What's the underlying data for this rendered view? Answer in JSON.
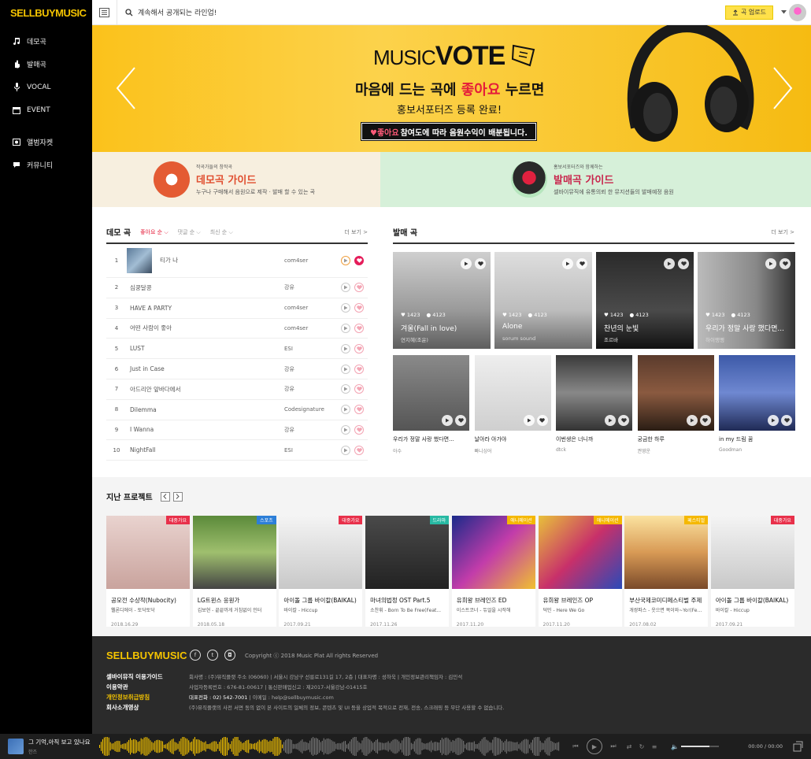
{
  "brand": {
    "logo": "SELLBUYMUSIC"
  },
  "sidebar": {
    "main": [
      {
        "label": "데모곡",
        "icon": "music-note-icon"
      },
      {
        "label": "발매곡",
        "icon": "hand-icon"
      },
      {
        "label": "VOCAL",
        "icon": "microphone-icon"
      },
      {
        "label": "EVENT",
        "icon": "calendar-icon"
      }
    ],
    "sub": [
      {
        "label": "앨범자켓",
        "icon": "album-icon"
      },
      {
        "label": "커뮤니티",
        "icon": "chat-icon"
      }
    ]
  },
  "topbar": {
    "search_value": "계속해서 공개되는 라인업!",
    "upload_label": "곡 업로드"
  },
  "banner": {
    "title_pre": "MUSIC",
    "title_main": "VOTE",
    "headline_pre": "마음에 드는 곡에 ",
    "headline_em": "좋아요",
    "headline_post": " 누르면",
    "subline": "홍보서포터즈 등록 완료!",
    "strip_em": "♥좋아요",
    "strip_text": " 참여도에 따라 음원수익이 배분됩니다."
  },
  "guides": {
    "demo": {
      "small": "작곡가들의 창작곡",
      "title": "데모곡 가이드",
      "desc": "누구나 구매해서 음원으로 제작 · 발매 할 수 있는 곡"
    },
    "release": {
      "small": "홍보서포터즈와 함께하는",
      "title": "발매곡 가이드",
      "desc": "셀바이뮤직에 유통의뢰 한 뮤지션들의 발매예정 음원"
    }
  },
  "demo": {
    "title": "데모 곡",
    "sorts": [
      "좋아요 순",
      "댓글 순",
      "최신 순"
    ],
    "more": "더 보기 >",
    "items": [
      {
        "rank": "1",
        "title": "티가 나",
        "artist": "com4ser"
      },
      {
        "rank": "2",
        "title": "심쿵달콩",
        "artist": "강유"
      },
      {
        "rank": "3",
        "title": "HAVE A PARTY",
        "artist": "com4ser"
      },
      {
        "rank": "4",
        "title": "어떤 사람이 좋아",
        "artist": "com4ser"
      },
      {
        "rank": "5",
        "title": "LUST",
        "artist": "ESI"
      },
      {
        "rank": "6",
        "title": "Just in Case",
        "artist": "강유"
      },
      {
        "rank": "7",
        "title": "아드리안 앞바다에서",
        "artist": "강유"
      },
      {
        "rank": "8",
        "title": "Dilemma",
        "artist": "Codesignature"
      },
      {
        "rank": "9",
        "title": "I Wanna",
        "artist": "강유"
      },
      {
        "rank": "10",
        "title": "NightFall",
        "artist": "ESI"
      }
    ]
  },
  "release": {
    "title": "발매 곡",
    "more": "더 보기 >",
    "featured": [
      {
        "title": "겨울(Fall in love)",
        "artist": "연지혜(조윤)",
        "likes": "1423",
        "comments": "4123"
      },
      {
        "title": "Alone",
        "artist": "sorum sound",
        "likes": "1423",
        "comments": "4123"
      },
      {
        "title": "찬년의 눈빛",
        "artist": "조르바",
        "likes": "1423",
        "comments": "4123"
      },
      {
        "title": "우리가 정말 사랑 했다면...",
        "artist": "하이맹멩",
        "likes": "1423",
        "comments": "4123"
      }
    ],
    "small": [
      {
        "title": "우리가 정말 사랑 했다면...",
        "artist": "아수"
      },
      {
        "title": "날아라 아가야",
        "artist": "빠니싱어"
      },
      {
        "title": "이번생은 너니까",
        "artist": "dtck"
      },
      {
        "title": "궁금한 하루",
        "artist": "권영운"
      },
      {
        "title": "in my 드림 꿈",
        "artist": "Goodman"
      }
    ]
  },
  "past": {
    "title": "지난 프로젝트",
    "items": [
      {
        "tag": "대중가요",
        "title": "공모전 수상작(Nubocity)",
        "sub": "웰론디에이 - 토닥토닥",
        "date": "2018.16.29",
        "tag_color": "#e8304a"
      },
      {
        "tag": "스포츠",
        "title": "LG트윈스 응원가",
        "sub": "김보현 - 끝끝까게 거침없이 인터",
        "date": "2018.05.18",
        "tag_color": "#2d7fd8"
      },
      {
        "tag": "대중가요",
        "title": "아이돌 그룹 바이칼(BAIKAL)",
        "sub": "바이칼 - Hiccup",
        "date": "2017.09.21",
        "tag_color": "#e8304a"
      },
      {
        "tag": "드라마",
        "title": "마녀의법정 OST Part.5",
        "sub": "소찬휘 - Born To Be Free(Feat...",
        "date": "2017.11.26",
        "tag_color": "#27b9a3"
      },
      {
        "tag": "애니메이션",
        "title": "유희왕 브레인즈 ED",
        "sub": "이스트코너 - 듀얼을 시작해",
        "date": "2017.11.20",
        "tag_color": "#f5b800"
      },
      {
        "tag": "애니메이션",
        "title": "유희왕 브레인즈 OP",
        "sub": "덕민 - Here We Go",
        "date": "2017.11.20",
        "tag_color": "#f5b800"
      },
      {
        "tag": "페스티벌",
        "title": "부산국제코미디페스티벌 주제",
        "sub": "개쌍파스 - 웃으면 복이와~Yo!(Feat.유",
        "date": "2017.08.02",
        "tag_color": "#f5b800"
      },
      {
        "tag": "대중가요",
        "title": "아이돌 그룹 바이칼(BAIKAL)",
        "sub": "바이칼 - Hiccup",
        "date": "2017.09.21",
        "tag_color": "#e8304a"
      }
    ]
  },
  "footer": {
    "logo": "SELLBUYMUSIC",
    "copyright": "Copyright ⓒ 2018 Music Plat All rights Reserved",
    "links": [
      "셀바이뮤직 이용가이드",
      "이용약관",
      "개인정보취급방침",
      "회사소개영상"
    ],
    "info": [
      {
        "text": "회사명 : (주)뮤직플랫 주소 (06060) | 서울시 강남구 선릉로131길 17, 2층 | 대표자명 : 성하욱 | 개인정보관리책임자 : 김민석"
      },
      {
        "text": "사업자등록번호 : 676-81-00617 | 통신판매업신고 : 제2017-서울강남-01415호"
      },
      {
        "bold": "대표전화 : 02) 542-7001",
        "text": " | 이메일 : help@sellbuymusic.com"
      },
      {
        "text": "(주)뮤직플랫의 사전 서면 동의 없이 본 사이트의 일체의 정보, 콘텐츠 및 UI 등을 상업적 목적으로 전재, 전송, 스크래핑 등 무단 사용할 수 없습니다."
      }
    ]
  },
  "player": {
    "title": "그 기억,아직 보고 있나요",
    "artist": "한즈",
    "time": "00:00 / 00:00",
    "progress": 0.4,
    "volume": 0.75
  },
  "colors": {
    "accent": "#f5c400",
    "love": "#e51d5a"
  }
}
